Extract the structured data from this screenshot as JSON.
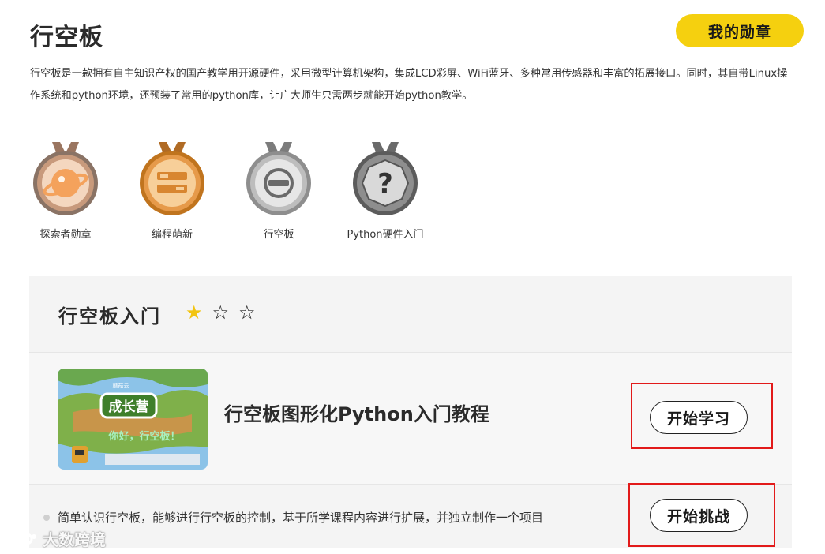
{
  "header": {
    "title": "行空板",
    "badge_button": "我的勋章"
  },
  "description": "行空板是一款拥有自主知识产权的国产教学用开源硬件，采用微型计算机架构，集成LCD彩屏、WiFi蓝牙、多种常用传感器和丰富的拓展接口。同时，其自带Linux操作系统和python环境，还预装了常用的python库，让广大师生只需两步就能开始python教学。",
  "medals": [
    {
      "label": "探索者勋章",
      "icon": "explorer-planet-icon"
    },
    {
      "label": "编程萌新",
      "icon": "coding-novice-icon"
    },
    {
      "label": "行空板",
      "icon": "unihiker-board-icon"
    },
    {
      "label": "Python硬件入门",
      "icon": "question-mark-icon"
    }
  ],
  "course": {
    "title": "行空板入门",
    "rating": {
      "filled": 1,
      "total": 3
    },
    "lesson": {
      "title": "行空板图形化Python入门教程",
      "button": "开始学习",
      "thumbnail": {
        "logo_text": "成长营",
        "caption": "你好，行空板！",
        "brand": "蘑菇云"
      }
    },
    "challenge": {
      "text": "简单认识行空板，能够进行行空板的控制，基于所学课程内容进行扩展，并独立制作一个项目",
      "button": "开始挑战"
    }
  },
  "watermark": "大数跨境",
  "colors": {
    "accent_yellow": "#f5d00f",
    "highlight_red": "#e21a1a",
    "panel_bg": "#f4f4f4"
  }
}
